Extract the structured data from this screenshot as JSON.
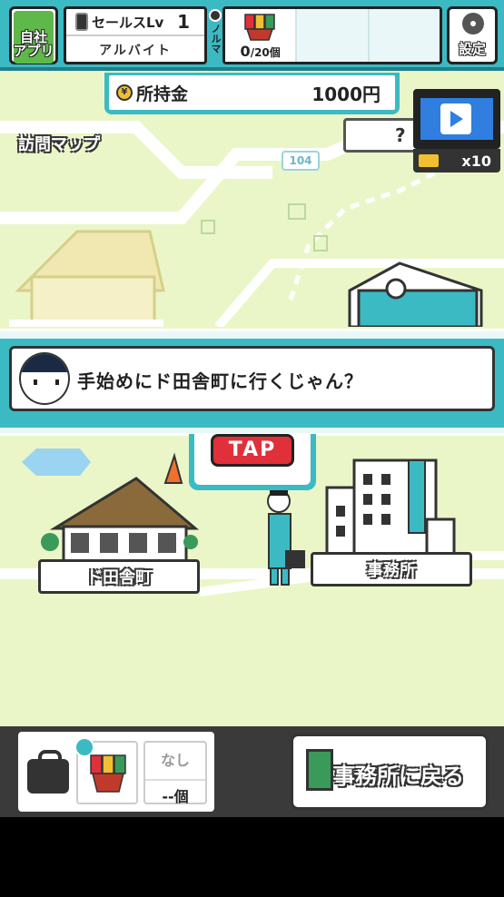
{
  "hud": {
    "app_button": "自社\nアプリ",
    "sales_title": "セールスLv",
    "sales_level": "1",
    "job_title": "アルバイト",
    "norma_label": "ノルマ",
    "quota_count": "0",
    "quota_total": "/20個",
    "settings_label": "設定"
  },
  "money": {
    "label": "所持金",
    "value": "1000円"
  },
  "map": {
    "title": "訪問マップ",
    "unknown_place": "?",
    "road_number": "104",
    "video_count": "x10"
  },
  "dialog": {
    "text": "手始めにド田舎町に行くじゃん？"
  },
  "tap": {
    "label": "TAP"
  },
  "places": {
    "inaka": "ド田舎町",
    "office": "事務所"
  },
  "bottom": {
    "item_name": "なし",
    "item_qty": "--個",
    "back_button": "事務所に戻る"
  }
}
